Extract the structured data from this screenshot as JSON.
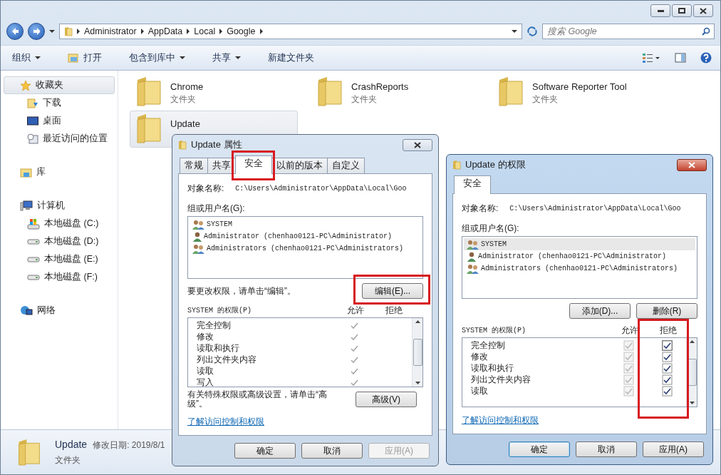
{
  "address_bar": {
    "crumbs": [
      "Administrator",
      "AppData",
      "Local",
      "Google"
    ]
  },
  "search": {
    "placeholder": "搜索 Google"
  },
  "toolbar": {
    "items": [
      {
        "label": "组织",
        "kind": "menu"
      },
      {
        "label": "打开",
        "kind": "open"
      },
      {
        "label": "包含到库中",
        "kind": "menu"
      },
      {
        "label": "共享",
        "kind": "menu"
      },
      {
        "label": "新建文件夹",
        "kind": "plain"
      }
    ]
  },
  "nav": {
    "groups": [
      {
        "label": "收藏夹",
        "kind": "star",
        "selected": true,
        "children": [
          {
            "label": "下载",
            "kind": "download",
            "selected": false
          },
          {
            "label": "桌面",
            "kind": "desktop",
            "selected": false
          },
          {
            "label": "最近访问的位置",
            "kind": "recent",
            "selected": false
          }
        ]
      },
      {
        "label": "库",
        "kind": "library",
        "selected": false
      },
      {
        "label": "计算机",
        "kind": "computer",
        "selected": false,
        "children": [
          {
            "label": "本地磁盘 (C:)",
            "kind": "system-drive",
            "selected": false
          },
          {
            "label": "本地磁盘 (D:)",
            "kind": "drive",
            "selected": false
          },
          {
            "label": "本地磁盘 (E:)",
            "kind": "drive",
            "selected": false
          },
          {
            "label": "本地磁盘 (F:)",
            "kind": "drive",
            "selected": false
          }
        ]
      },
      {
        "label": "网络",
        "kind": "network",
        "selected": false
      }
    ]
  },
  "files": [
    {
      "name": "Chrome",
      "type": "文件夹",
      "selected": false
    },
    {
      "name": "CrashReports",
      "type": "文件夹",
      "selected": false
    },
    {
      "name": "Software Reporter Tool",
      "type": "文件夹",
      "selected": false
    },
    {
      "name": "Update",
      "selected": true
    }
  ],
  "details": {
    "name": "Update",
    "meta": "修改日期: 2019/8/1",
    "type": "文件夹"
  },
  "properties_dialog": {
    "title": "Update 属性",
    "active": false,
    "tabs": [
      {
        "label": "常规",
        "selected": false,
        "highlighted": false
      },
      {
        "label": "共享",
        "selected": false,
        "highlighted": false
      },
      {
        "label": "安全",
        "selected": true,
        "highlighted": true
      },
      {
        "label": "以前的版本",
        "selected": false,
        "highlighted": false
      },
      {
        "label": "自定义",
        "selected": false,
        "highlighted": false
      }
    ],
    "object_label": "对象名称:",
    "object_path": "C:\\Users\\Administrator\\AppData\\Local\\Goo",
    "users_label": "组或用户名(G):",
    "users": [
      {
        "name": "SYSTEM",
        "kind": "group",
        "selected": false
      },
      {
        "name": "Administrator (chenhao0121-PC\\Administrator)",
        "kind": "user",
        "selected": false
      },
      {
        "name": "Administrators (chenhao0121-PC\\Administrators)",
        "kind": "group",
        "selected": false
      }
    ],
    "users_hint": "要更改权限，请单击“编辑”。",
    "user_buttons": [
      {
        "label": "编辑(E)...",
        "highlighted": true
      }
    ],
    "permissions_label": "SYSTEM 的权限(P)",
    "allow_label": "允许",
    "deny_label": "拒绝",
    "permissions": {
      "kind": "readonly",
      "deny_highlighted": false,
      "rows": [
        {
          "label": "完全控制",
          "allow": true,
          "deny": false
        },
        {
          "label": "修改",
          "allow": true,
          "deny": false
        },
        {
          "label": "读取和执行",
          "allow": true,
          "deny": false
        },
        {
          "label": "列出文件夹内容",
          "allow": true,
          "deny": false
        },
        {
          "label": "读取",
          "allow": true,
          "deny": false
        },
        {
          "label": "写入",
          "allow": true,
          "deny": false
        }
      ]
    },
    "advanced_hint": "有关特殊权限或高级设置，请单击“高级”。",
    "advanced_button": "高级(V)",
    "link": "了解访问控制和权限",
    "buttons": [
      {
        "label": "确定",
        "default": false,
        "disabled": false
      },
      {
        "label": "取消",
        "default": false,
        "disabled": false
      },
      {
        "label": "应用(A)",
        "default": false,
        "disabled": true
      }
    ]
  },
  "permissions_dialog": {
    "title": "Update 的权限",
    "active": true,
    "tabs": [
      {
        "label": "安全",
        "selected": true,
        "highlighted": false
      }
    ],
    "object_label": "对象名称:",
    "object_path": "C:\\Users\\Administrator\\AppData\\Local\\Goo",
    "users_label": "组或用户名(G):",
    "users": [
      {
        "name": "SYSTEM",
        "kind": "group",
        "selected": true
      },
      {
        "name": "Administrator (chenhao0121-PC\\Administrator)",
        "kind": "user",
        "selected": false
      },
      {
        "name": "Administrators (chenhao0121-PC\\Administrators)",
        "kind": "group",
        "selected": false
      }
    ],
    "user_buttons": [
      {
        "label": "添加(D)...",
        "highlighted": false
      },
      {
        "label": "删除(R)",
        "highlighted": false
      }
    ],
    "permissions_label": "SYSTEM 的权限(P)",
    "allow_label": "允许",
    "deny_label": "拒绝",
    "permissions": {
      "kind": "checkbox",
      "allow_disabled": true,
      "deny_highlighted": true,
      "rows": [
        {
          "label": "完全控制",
          "allow": true,
          "deny": true,
          "focused": true
        },
        {
          "label": "修改",
          "allow": true,
          "deny": true,
          "focused": false
        },
        {
          "label": "读取和执行",
          "allow": true,
          "deny": true,
          "focused": false
        },
        {
          "label": "列出文件夹内容",
          "allow": true,
          "deny": true,
          "focused": false
        },
        {
          "label": "读取",
          "allow": true,
          "deny": true,
          "focused": false
        }
      ]
    },
    "link": "了解访问控制和权限",
    "buttons": [
      {
        "label": "确定",
        "default": true,
        "disabled": false
      },
      {
        "label": "取消",
        "default": false,
        "disabled": false
      },
      {
        "label": "应用(A)",
        "default": false,
        "disabled": false
      }
    ]
  }
}
